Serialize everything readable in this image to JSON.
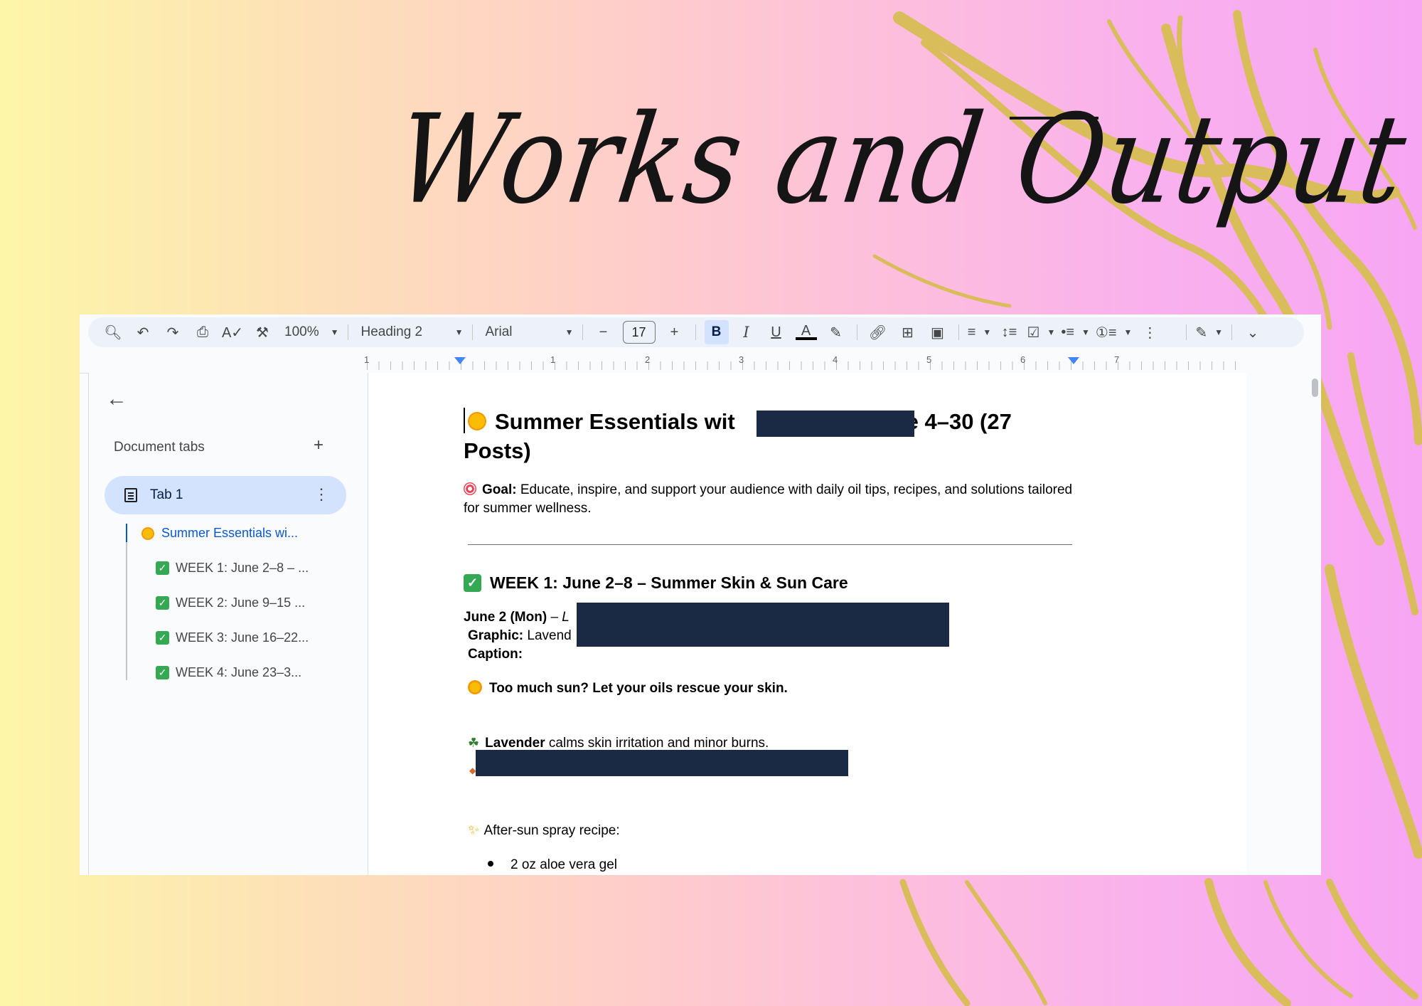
{
  "slide": {
    "title": "Works and Output"
  },
  "toolbar": {
    "zoom": "100%",
    "style": "Heading 2",
    "font": "Arial",
    "font_size": "17",
    "bold_label": "B",
    "italic_label": "I",
    "underline_label": "U",
    "text_color_label": "A"
  },
  "ruler": {
    "numbers": [
      "1",
      "1",
      "2",
      "3",
      "4",
      "5",
      "6",
      "7"
    ]
  },
  "sidebar": {
    "heading": "Document tabs",
    "tab_label": "Tab 1",
    "outline": [
      {
        "label": "Summer Essentials wi...",
        "active": true
      },
      {
        "label": "WEEK 1: June 2–8 – ..."
      },
      {
        "label": "WEEK 2: June 9–15 ..."
      },
      {
        "label": "WEEK 3: June 16–22..."
      },
      {
        "label": "WEEK 4: June 23–3..."
      }
    ]
  },
  "document": {
    "title_part1": "Summer Essentials wit",
    "title_part2": "ne 4–30 (27",
    "title_line2": "Posts)",
    "goal_label": "Goal:",
    "goal_text": " Educate, inspire, and support your audience with daily oil tips, recipes, and solutions tailored for summer wellness.",
    "week1_heading": "WEEK 1: June 2–8 – Summer Skin & Sun Care",
    "day_label": "June 2 (Mon)",
    "day_dash": " – L",
    "graphic_label": "Graphic:",
    "graphic_text": " Lavend",
    "caption_label": "Caption:",
    "hook": "Too much sun? Let your oils rescue your skin.",
    "lavender_bold": "Lavender",
    "lavender_text": " calms skin irritation and minor burns.",
    "spray_intro": "After-sun spray recipe:",
    "bullet1": "2 oz aloe vera gel"
  },
  "colors": {
    "redaction": "#1b2a44",
    "accent_blue": "#0b57d0",
    "check_green": "#34a853",
    "swirl_gold": "#d9bd5a"
  }
}
